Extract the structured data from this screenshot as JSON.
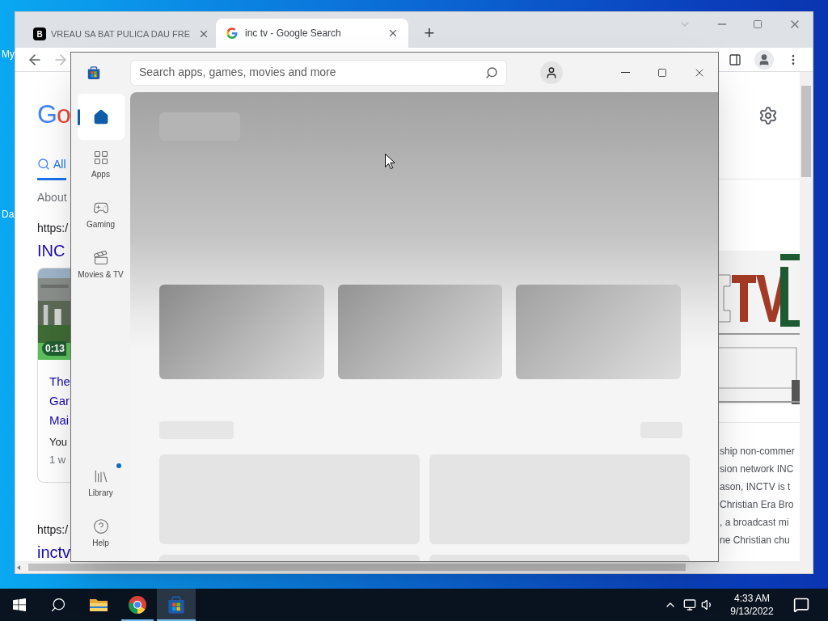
{
  "desktop": {
    "icon_labels": [
      "My",
      "Da"
    ]
  },
  "browser": {
    "tabs": [
      {
        "title": "VREAU SA BAT PULICA DAU FRE",
        "selected": false,
        "favicon": {
          "kind": "letter",
          "text": "B"
        }
      },
      {
        "title": "inc tv - Google Search",
        "selected": true,
        "favicon": {
          "kind": "google"
        }
      }
    ],
    "new_tab": "+",
    "page": {
      "logo": "Go",
      "search_tabs": [
        {
          "label": "All",
          "selected": true
        }
      ],
      "result_stats": "About",
      "results": [
        {
          "url": "https:/",
          "title": "INC",
          "video": {
            "duration": "0:13",
            "title_lines": [
              "The",
              "Gar",
              "Mai"
            ],
            "source": "You",
            "age": "1 w"
          }
        },
        {
          "url": "https:/",
          "title": "inctv"
        }
      ],
      "description_lines": [
        "ship non-commer",
        "sion network INC",
        "ason, INCTV is t",
        "Christian Era Bro",
        ", a broadcast mi",
        "ne Christian chu"
      ]
    }
  },
  "store": {
    "search": {
      "placeholder": "Search apps, games, movies and more"
    },
    "nav": [
      {
        "kind": "home",
        "selected": true,
        "badge": false
      },
      {
        "kind": "apps",
        "label": "Apps",
        "selected": false,
        "badge": false
      },
      {
        "kind": "gaming",
        "label": "Gaming",
        "selected": false,
        "badge": false
      },
      {
        "kind": "movies",
        "label": "Movies & TV",
        "selected": false,
        "badge": false
      },
      {
        "kind": "library",
        "label": "Library",
        "selected": false,
        "badge": true
      },
      {
        "kind": "help",
        "label": "Help",
        "selected": false,
        "badge": false
      }
    ]
  },
  "taskbar": {
    "items": [
      {
        "kind": "start",
        "selected": false,
        "running": false
      },
      {
        "kind": "search",
        "selected": false,
        "running": false
      },
      {
        "kind": "explorer",
        "selected": false,
        "running": false
      },
      {
        "kind": "chrome",
        "selected": false,
        "running": true
      },
      {
        "kind": "store",
        "selected": true,
        "running": true
      }
    ],
    "clock": {
      "time": "4:33 AM",
      "date": "9/13/2022"
    }
  }
}
